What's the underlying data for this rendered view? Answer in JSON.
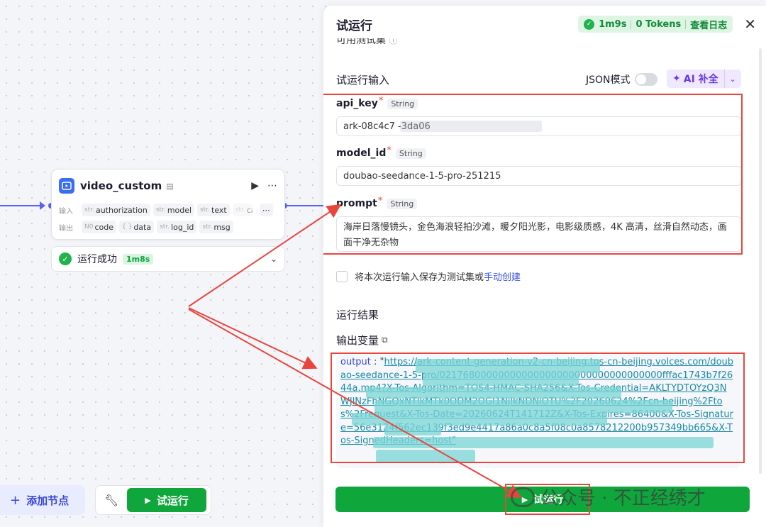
{
  "node": {
    "title": "video_custom",
    "input_label": "输入",
    "output_label": "输出",
    "inputs": [
      {
        "type": "str.",
        "name": "authorization"
      },
      {
        "type": "str.",
        "name": "model"
      },
      {
        "type": "str.",
        "name": "text"
      },
      {
        "type": "str.",
        "name": "ca"
      }
    ],
    "outputs": [
      {
        "type": "N0",
        "name": "code"
      },
      {
        "type": "{ }",
        "name": "data"
      },
      {
        "type": "str.",
        "name": "log_id"
      },
      {
        "type": "str.",
        "name": "msg"
      }
    ],
    "status_text": "运行成功",
    "status_time": "1m8s"
  },
  "toolbar": {
    "add_node_label": "添加节点",
    "run_label": "试运行"
  },
  "panel": {
    "title": "试运行",
    "run_time": "1m9s",
    "tokens": "0 Tokens",
    "view_log": "查看日志",
    "testset_label": "可用测试集",
    "input_section": "试运行输入",
    "json_mode": "JSON模式",
    "ai_fill": "AI 补全",
    "fields": [
      {
        "name": "api_key",
        "type": "String",
        "value": "ark-08c4c7          -3da06"
      },
      {
        "name": "model_id",
        "type": "String",
        "value": "doubao-seedance-1-5-pro-251215"
      },
      {
        "name": "prompt",
        "type": "String",
        "value": "海岸日落慢镜头，金色海浪轻拍沙滩，暖夕阳光影，电影级质感，4K 高清，丝滑自然动态，画面干净无杂物"
      }
    ],
    "save_text": "将本次运行输入保存为测试集或",
    "save_link": "手动创建",
    "result_section": "运行结果",
    "output_vars": "输出变量",
    "output_key": "output",
    "output_url": "https://ark-content-generation-v2-cn-beijing.tos-cn-beijing.volces.com/doubao-seedance-1-5-pro/02176800000000000000000000000000000000fffac1743b7f2644a.mp4?X-Tos-Algorithm=TOS4-HMAC-SHA256&X-Tos-Credential=AKLTYDTOYzQ3NWJlNzFhNGQxNTlkMTk0ODM2OGI1NjlkNDNiOTU%2F20260624%2Fcn-beijing%2Ftos%2Frequest&X-Tos-Date=20260624T141712Z&X-Tos-Expires=86400&X-Tos-Signature=56e3124f562ec139f3ed9e4417a86a0c8a5f08c0a8578212200b957349bb665&X-Tos-SignedHeaders=host\"",
    "run_button": "试运行"
  },
  "watermark": "公众号 · 不正经绣才",
  "colors": {
    "accent": "#5b62f0",
    "success": "#0fa73c",
    "annotation_red": "#e8463d",
    "link": "#1a8aa6"
  }
}
